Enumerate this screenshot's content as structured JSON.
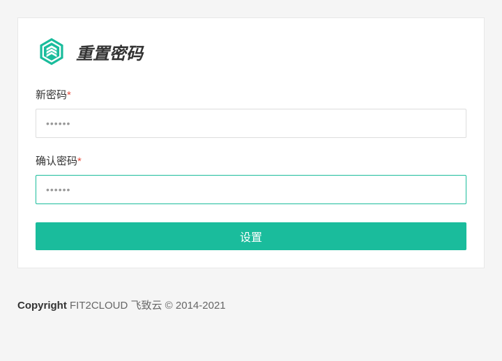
{
  "header": {
    "title": "重置密码"
  },
  "form": {
    "new_password": {
      "label": "新密码",
      "required_mark": "*",
      "value": "••••••"
    },
    "confirm_password": {
      "label": "确认密码",
      "required_mark": "*",
      "value": "••••••"
    },
    "submit_label": "设置"
  },
  "footer": {
    "copyright_bold": "Copyright",
    "copyright_text": " FIT2CLOUD 飞致云 © 2014-2021"
  },
  "colors": {
    "accent": "#1abc9c",
    "required": "#e74c3c"
  }
}
